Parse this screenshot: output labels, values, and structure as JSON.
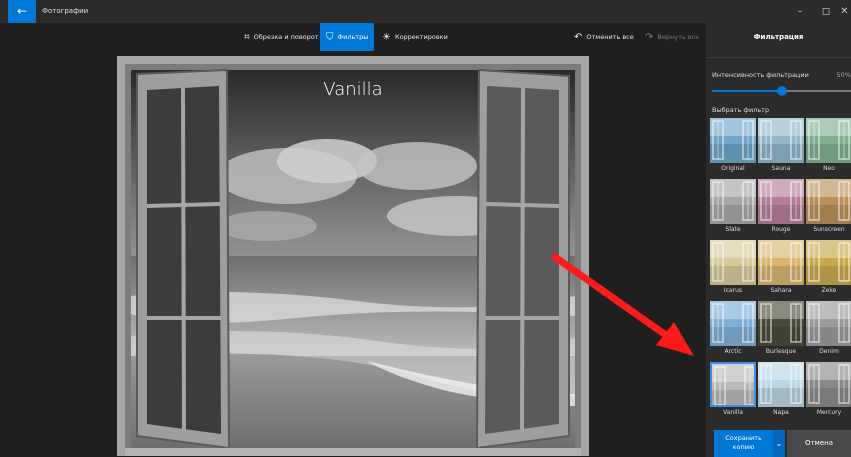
{
  "window": {
    "app_title": "Фотографии",
    "back_glyph": "←",
    "minimize_glyph": "–",
    "maximize_glyph": "◻",
    "close_glyph": "✕"
  },
  "toolbar": {
    "crop_icon": "crop-rotate-icon",
    "crop_label": "Обрезка и поворот",
    "filters_icon": "filter-icon",
    "filters_label": "Фильтры",
    "adjust_icon": "sun-icon",
    "adjust_label": "Корректировки",
    "undo_label": "Отменить все",
    "redo_label": "Вернуть все"
  },
  "photo": {
    "overlay_label": "Vanilla"
  },
  "panel": {
    "title": "Фильтрация",
    "intensity_label": "Интенсивность фильтрации",
    "intensity_value": "50%",
    "intensity_fraction": 0.5,
    "choose_label": "Выбрать фильтр",
    "filters": [
      {
        "name": "Original",
        "tint": "#6fa6c9"
      },
      {
        "name": "Sauna",
        "tint": "#8fb7c9"
      },
      {
        "name": "Neo",
        "tint": "#7fb08f"
      },
      {
        "name": "Slate",
        "tint": "#a7a7a7"
      },
      {
        "name": "Rouge",
        "tint": "#b57d9a"
      },
      {
        "name": "Sunscreen",
        "tint": "#b9915a"
      },
      {
        "name": "Icarus",
        "tint": "#d6c99a"
      },
      {
        "name": "Sahara",
        "tint": "#d9b56f"
      },
      {
        "name": "Zeke",
        "tint": "#c9a94e"
      },
      {
        "name": "Arctic",
        "tint": "#7fb0d8"
      },
      {
        "name": "Burlesque",
        "tint": "#4a4a3a"
      },
      {
        "name": "Denim",
        "tint": "#9a9a9a"
      },
      {
        "name": "Vanilla",
        "tint": "#b9b9b9"
      },
      {
        "name": "Napa",
        "tint": "#b9d4e2"
      },
      {
        "name": "Mercury",
        "tint": "#8a8a8a"
      }
    ],
    "selected_filter": "Vanilla",
    "save_label_line1": "Сохранить",
    "save_label_line2": "копию",
    "cancel_label": "Отмена"
  },
  "colors": {
    "accent": "#0078d7",
    "annotation_arrow": "#ff1a1a"
  }
}
